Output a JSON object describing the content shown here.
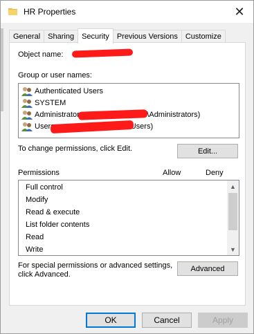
{
  "window": {
    "title": "HR Properties",
    "close_glyph": "✕",
    "icon": "folder-icon"
  },
  "tabs": [
    {
      "label": "General"
    },
    {
      "label": "Sharing"
    },
    {
      "label": "Security",
      "active": true
    },
    {
      "label": "Previous Versions"
    },
    {
      "label": "Customize"
    }
  ],
  "security": {
    "object_name_label": "Object name:",
    "group_label": "Group or user names:",
    "users": [
      {
        "name": "Authenticated Users"
      },
      {
        "name": "SYSTEM"
      },
      {
        "name": "Administrators",
        "suffix": "\\Administrators)"
      },
      {
        "name": "Users",
        "suffix": "Users)"
      }
    ],
    "change_text": "To change permissions, click Edit.",
    "edit_button": "Edit...",
    "permissions_label": "Permissions",
    "allow_label": "Allow",
    "deny_label": "Deny",
    "permissions": [
      {
        "name": "Full control"
      },
      {
        "name": "Modify"
      },
      {
        "name": "Read & execute"
      },
      {
        "name": "List folder contents"
      },
      {
        "name": "Read"
      },
      {
        "name": "Write"
      }
    ],
    "special_text_line1": "For special permissions or advanced settings,",
    "special_text_line2": "click Advanced.",
    "advanced_button": "Advanced"
  },
  "buttons": {
    "ok": "OK",
    "cancel": "Cancel",
    "apply": "Apply"
  },
  "colors": {
    "redaction": "#ff1a1a",
    "accent": "#0078d7"
  }
}
